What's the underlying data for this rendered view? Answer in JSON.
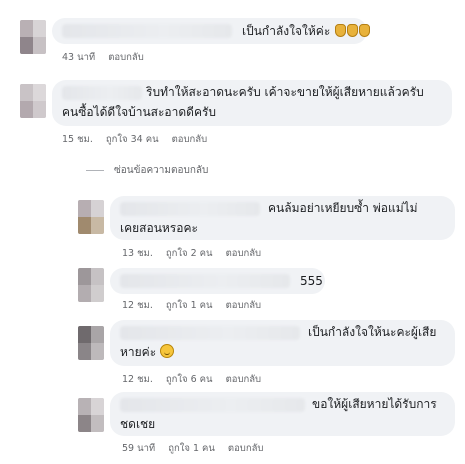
{
  "comments": [
    {
      "text": "เป็นกำลังใจให้ค่ะ",
      "time": "43 นาที",
      "reply": "ตอบกลับ"
    },
    {
      "line1": "ริบทำให้สะอาดนะครับ  เค้าจะขายให้ผู้เสียหายแล้วครับ",
      "line2": "คนซื้อได้ดีใจบ้านสะอาดดีครับ",
      "time": "15 ชม.",
      "likes": "ถูกใจ 34 คน",
      "reply": "ตอบกลับ"
    }
  ],
  "hide_replies": "ซ่อนข้อความตอบกลับ",
  "replies": [
    {
      "line1": "คนล้มอย่าเหยียบซ้ำ  พ่อแม่ไม่",
      "line2": "เคยสอนหรอคะ",
      "time": "13 ชม.",
      "likes": "ถูกใจ 2 คน",
      "reply": "ตอบกลับ"
    },
    {
      "text": "555",
      "time": "12 ชม.",
      "likes": "ถูกใจ 1 คน",
      "reply": "ตอบกลับ"
    },
    {
      "line1": "เป็นกำลังใจให้นะคะผู้เสีย",
      "line2": "หายค่ะ",
      "time": "12 ชม.",
      "likes": "ถูกใจ 6 คน",
      "reply": "ตอบกลับ"
    },
    {
      "line1": "ขอให้ผู้เสียหายได้รับการ",
      "line2": "ชดเชย",
      "time": "59 นาที",
      "likes": "ถูกใจ 1 คน",
      "reply": "ตอบกลับ"
    }
  ],
  "icons": {
    "clap": "clapping-hands-icon",
    "smile": "grinning-face-icon"
  }
}
